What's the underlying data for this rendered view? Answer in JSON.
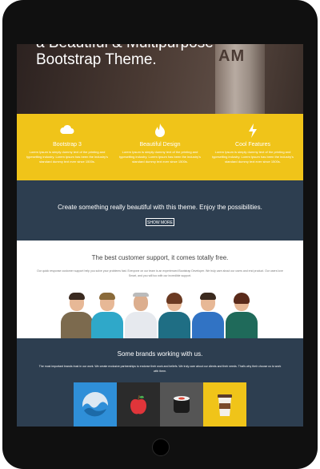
{
  "hero": {
    "title": "a Beautiful & Multipurpose Bootstrap Theme.",
    "cup_text": "AM"
  },
  "features": [
    {
      "icon": "cloud-icon",
      "title": "Bootstrap 3",
      "text": "Lorem Ipsum is simply dummy text of the printing and typesetting industry. Lorem Ipsum has been the industry's standard dummy text ever since 1500s."
    },
    {
      "icon": "flame-icon",
      "title": "Beautiful Design",
      "text": "Lorem Ipsum is simply dummy text of the printing and typesetting industry. Lorem Ipsum has been the industry's standard dummy text ever since 1500s."
    },
    {
      "icon": "bolt-icon",
      "title": "Cool Features",
      "text": "Lorem Ipsum is simply dummy text of the printing and typesetting industry. Lorem Ipsum has been the industry's standard dummy text ever since 1500s."
    }
  ],
  "cta": {
    "text": "Create something really beautiful with this theme. Enjoy the possibilities.",
    "button_label": "SHOW MORE"
  },
  "support": {
    "title": "The best customer support, it comes totally free.",
    "description": "Our quick response customer support help you solve your problems fast. Everyone on our team is an experienced Bootstrap Developer. We truly care about our users and end product. Our users love Smart, and you will too with our incredible support."
  },
  "brands": {
    "title": "Some brands working with us.",
    "description": "The most important brands trust in our work. We create exclusive partnerships to endorse their work and beliefs. We truly care about our clients and their needs. That's why their choose us to work with them.",
    "logos": [
      {
        "icon": "wave-icon",
        "color": "#2f8fd8"
      },
      {
        "icon": "apple-icon",
        "color": "#2b2b2b"
      },
      {
        "icon": "sushi-icon",
        "color": "#555555"
      },
      {
        "icon": "coffee-cup-icon",
        "color": "#f0c419"
      }
    ]
  },
  "colors": {
    "accent_yellow": "#f0c419",
    "navy": "#2d3e50"
  }
}
